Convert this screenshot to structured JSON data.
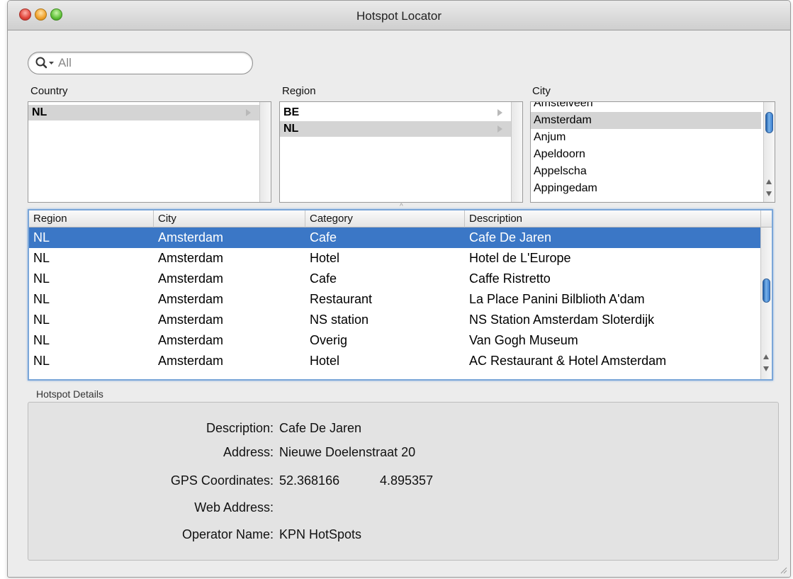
{
  "window": {
    "title": "Hotspot Locator"
  },
  "search": {
    "placeholder": "All"
  },
  "browser": {
    "country_label": "Country",
    "region_label": "Region",
    "city_label": "City",
    "countries": [
      "NL"
    ],
    "regions": [
      "BE",
      "NL"
    ],
    "cities": [
      "Amstelveen",
      "Amsterdam",
      "Anjum",
      "Apeldoorn",
      "Appelscha",
      "Appingedam"
    ]
  },
  "table": {
    "headers": [
      "Region",
      "City",
      "Category",
      "Description"
    ],
    "rows": [
      [
        "NL",
        "Amsterdam",
        "Cafe",
        "Cafe De Jaren"
      ],
      [
        "NL",
        "Amsterdam",
        "Hotel",
        "Hotel de L'Europe"
      ],
      [
        "NL",
        "Amsterdam",
        "Cafe",
        "Caffe Ristretto"
      ],
      [
        "NL",
        "Amsterdam",
        "Restaurant",
        "La Place Panini Bilblioth A'dam"
      ],
      [
        "NL",
        "Amsterdam",
        "NS station",
        "NS Station Amsterdam Sloterdijk"
      ],
      [
        "NL",
        "Amsterdam",
        "Overig",
        "Van Gogh Museum"
      ],
      [
        "NL",
        "Amsterdam",
        "Hotel",
        "AC Restaurant & Hotel Amsterdam"
      ]
    ]
  },
  "details": {
    "section_label": "Hotspot Details",
    "description_label": "Description:",
    "description_value": "Cafe De Jaren",
    "address_label": "Address:",
    "address_value": "Nieuwe Doelenstraat 20",
    "gps_label": "GPS Coordinates:",
    "gps_lat": "52.368166",
    "gps_lon": "4.895357",
    "web_label": "Web Address:",
    "web_value": "",
    "operator_label": "Operator Name:",
    "operator_value": "KPN HotSpots"
  },
  "colors": {
    "selection": "#3b77c6",
    "focus_ring": "#7aa6d8",
    "browser_selection": "#d4d4d4"
  }
}
